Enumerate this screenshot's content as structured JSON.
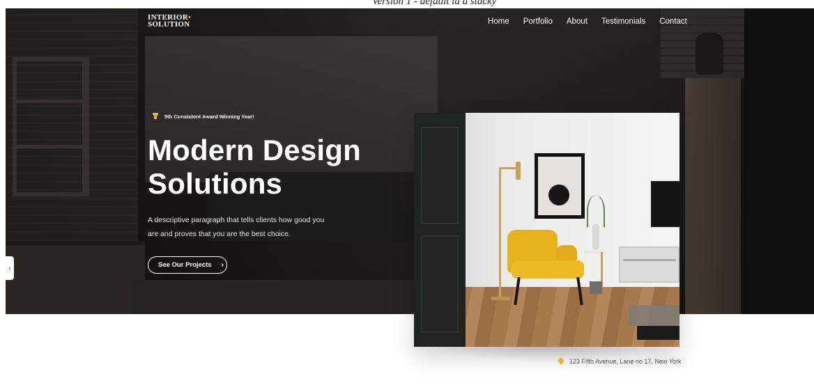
{
  "top_caption": "Version 1 - default la   a stacky",
  "brand": {
    "logo_line1": "INTERIOR",
    "logo_dot": "•",
    "logo_line2": "SOLUTION"
  },
  "nav": {
    "items": [
      {
        "label": "Home"
      },
      {
        "label": "Portfolio"
      },
      {
        "label": "About"
      },
      {
        "label": "Testimonials"
      },
      {
        "label": "Contact"
      }
    ]
  },
  "hero": {
    "award_text": "5th Consistent Award Winning Year!",
    "headline_line1": "Modern Design",
    "headline_line2": "Solutions",
    "paragraph": "A descriptive paragraph that tells clients how good you are and proves that you are the best choice.",
    "cta_label": "See Our Projects",
    "cta_icon": "›",
    "prev_icon": "‹"
  },
  "address": {
    "text": "123 Fifth Avenue, Lane no 17, New York"
  },
  "colors": {
    "accent": "#f0b429",
    "hero_dark": "#1e1d1c",
    "text_light": "#ffffff"
  }
}
